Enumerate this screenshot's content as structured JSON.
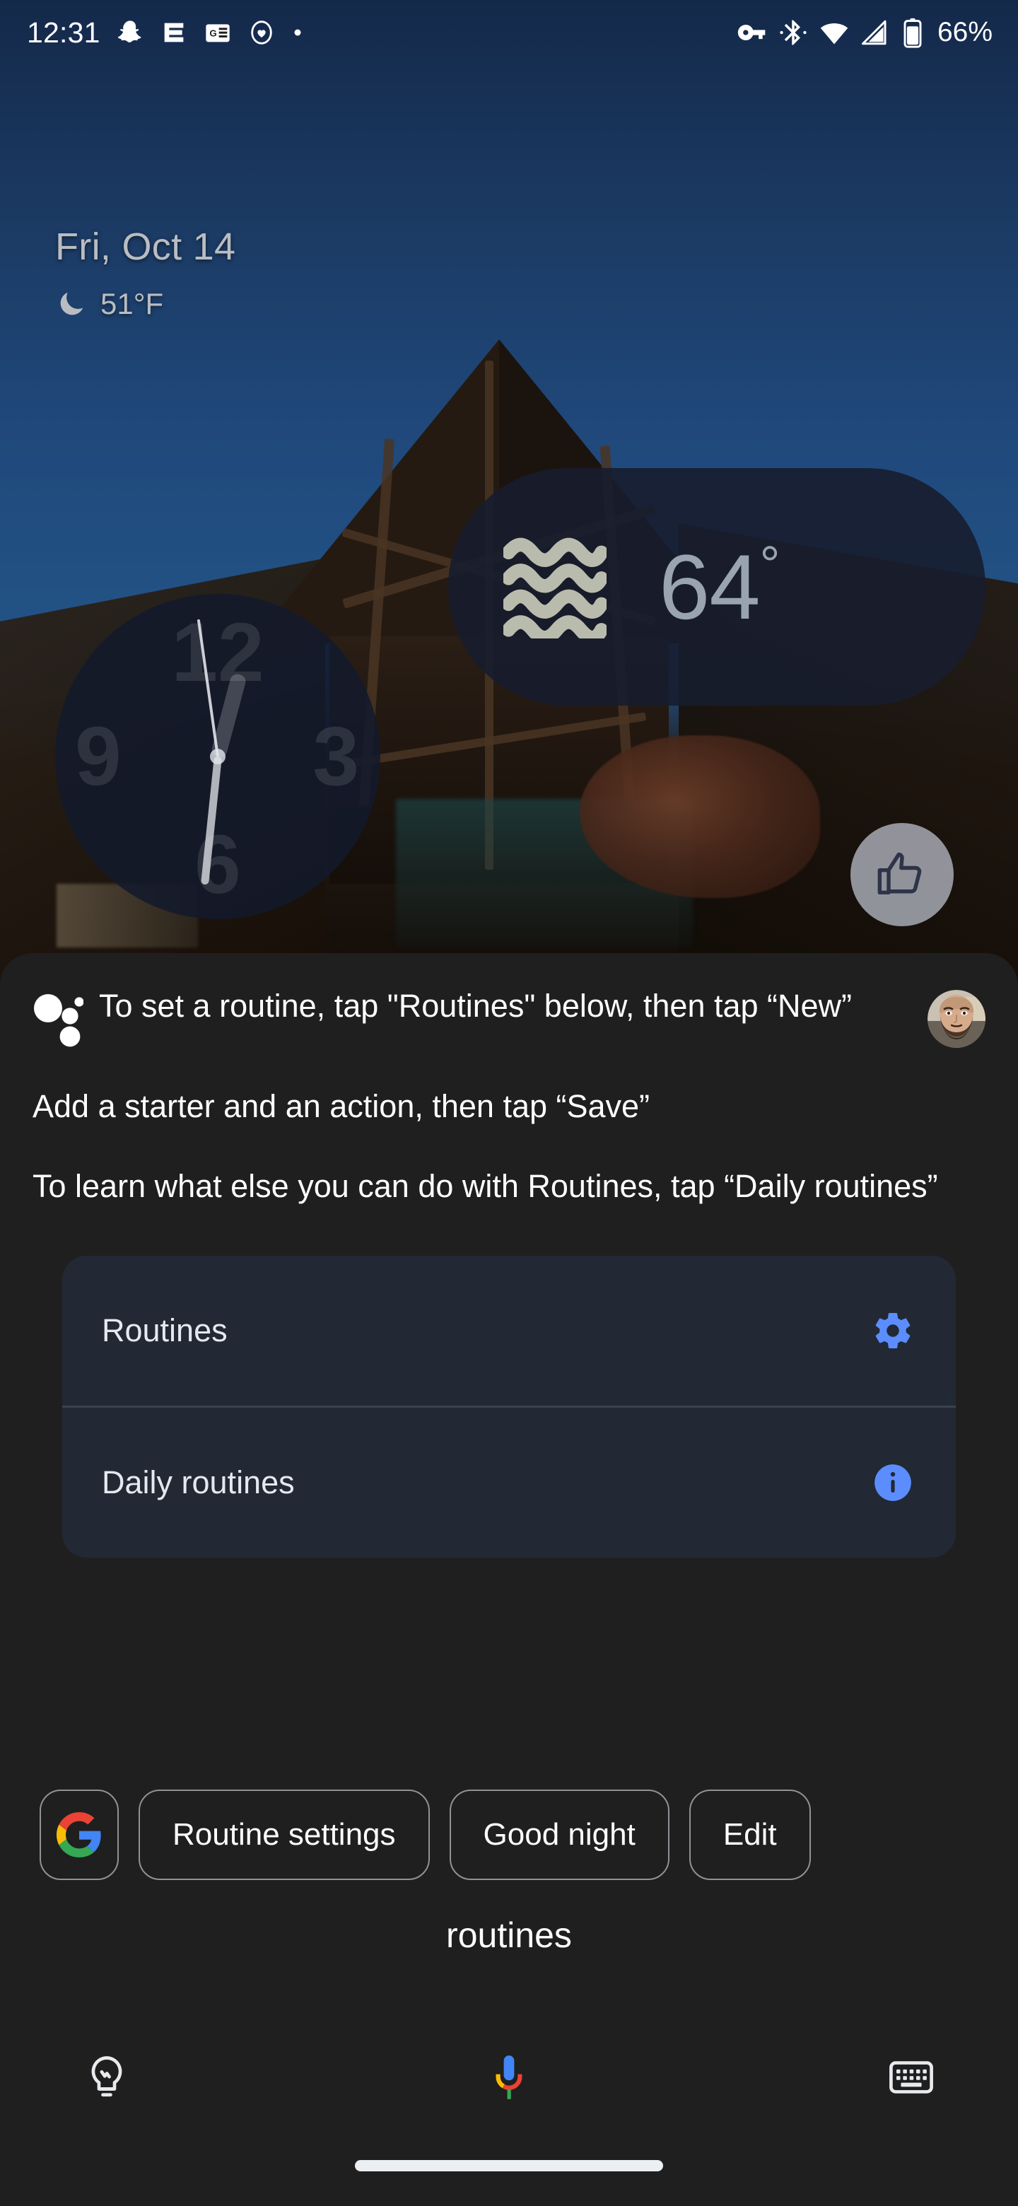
{
  "status_bar": {
    "time": "12:31",
    "battery_percent": "66%",
    "left_icons": [
      "snapchat-icon",
      "espn-icon",
      "google-news-icon",
      "heart-circle-icon",
      "dot-icon"
    ],
    "right_icons": [
      "vpn-key-icon",
      "bluetooth-icon",
      "wifi-icon",
      "cellular-signal-icon",
      "battery-icon"
    ]
  },
  "home_screen": {
    "date": "Fri, Oct 14",
    "weather_temp": "51°F",
    "weather_icon": "crescent-moon-icon",
    "clock_widget": {
      "numbers": [
        "12",
        "3",
        "6",
        "9"
      ],
      "time_shown": "12:31"
    },
    "thermostat_widget": {
      "temperature": "64",
      "degree": "°",
      "icon": "heat-waves-icon"
    },
    "feedback_button": "thumbs-up-icon"
  },
  "assistant": {
    "icon": "google-assistant-dots-icon",
    "avatar": "user-avatar",
    "response_paragraphs": [
      "To set a routine, tap \"Routines\" below, then tap “New”",
      "Add a starter and an action, then tap “Save”",
      "To learn what else you can do with Routines, tap “Daily routines”"
    ],
    "card": {
      "rows": [
        {
          "label": "Routines",
          "icon": "gear-icon",
          "icon_color": "#5b8dff"
        },
        {
          "label": "Daily routines",
          "icon": "info-icon",
          "icon_color": "#5b8dff"
        }
      ]
    },
    "chips": [
      {
        "label": "",
        "icon": "google-g-logo"
      },
      {
        "label": "Routine settings",
        "icon": ""
      },
      {
        "label": "Good night",
        "icon": ""
      },
      {
        "label": "Edit",
        "icon": ""
      }
    ],
    "transcript": "routines",
    "bottom_bar": [
      {
        "name": "explore-lightbulb-icon"
      },
      {
        "name": "google-mic-icon"
      },
      {
        "name": "keyboard-icon"
      }
    ]
  },
  "colors": {
    "accent_blue": "#5b8dff",
    "panel_bg": "#1f1f1f",
    "card_bg": "#222834",
    "google_blue": "#4285F4",
    "google_red": "#EA4335",
    "google_yellow": "#FBBC05",
    "google_green": "#34A853"
  }
}
